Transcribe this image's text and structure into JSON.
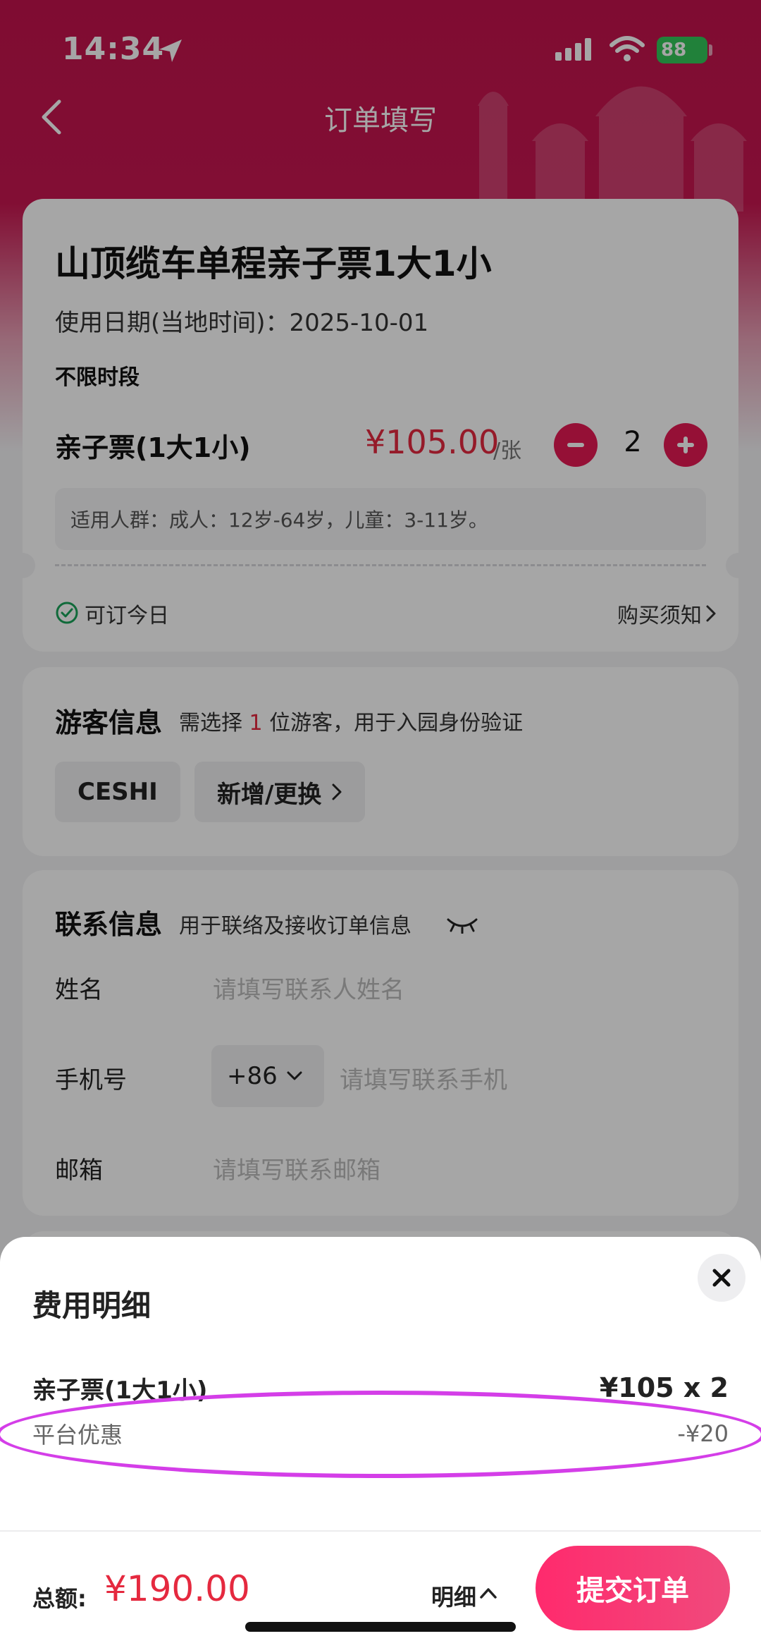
{
  "status_bar": {
    "time": "14:34",
    "battery": "88"
  },
  "nav": {
    "title": "订单填写"
  },
  "product": {
    "title": "山顶缆车单程亲子票1大1小",
    "use_date": "使用日期(当地时间)：2025-10-01",
    "time_slot": "不限时段",
    "ticket_name": "亲子票(1大1小)",
    "price": "¥105.00",
    "price_unit": "/张",
    "quantity": "2",
    "audience": "适用人群：成人：12岁-64岁，儿童：3-11岁。",
    "bookable_today": "可订今日",
    "purchase_notice": "购买须知"
  },
  "visitor": {
    "title": "游客信息",
    "sub_prefix": "需选择",
    "sub_count": "1",
    "sub_suffix": "位游客，用于入园身份验证",
    "chips": [
      "CESHI",
      "新增/更换"
    ]
  },
  "contact": {
    "title": "联系信息",
    "subtitle": "用于联络及接收订单信息",
    "name_label": "姓名",
    "name_placeholder": "请填写联系人姓名",
    "phone_label": "手机号",
    "country_code": "+86",
    "phone_placeholder": "请填写联系手机",
    "email_label": "邮箱",
    "email_placeholder": "请填写联系邮箱"
  },
  "fee_sheet": {
    "title": "费用明细",
    "item_name": "亲子票(1大1小)",
    "item_value": "¥105 x 2",
    "discount_name": "平台优惠",
    "discount_value": "-¥20"
  },
  "footer": {
    "total_label": "总额:",
    "total_value": "¥190.00",
    "detail_label": "明细",
    "submit_label": "提交订单"
  },
  "colors": {
    "brand": "#c4134e",
    "price": "#e5293f",
    "button": "#e51a54",
    "annotation": "#d43ee8"
  }
}
